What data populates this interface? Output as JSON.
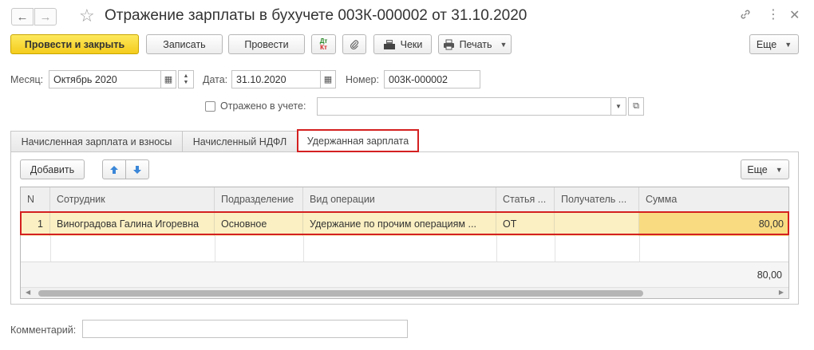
{
  "window": {
    "title": "Отражение зарплаты в бухучете 003К-000002 от 31.10.2020",
    "nav_back": "←",
    "nav_forward": "→",
    "icons": [
      "back-arrow-icon",
      "forward-arrow-icon",
      "star-icon",
      "link-icon",
      "more-icon",
      "close-icon"
    ]
  },
  "toolbar": {
    "post_and_close": "Провести и закрыть",
    "save": "Записать",
    "post": "Провести",
    "dtkt_dt": "Дт",
    "dtkt_kt": "Кт",
    "checks": "Чеки",
    "print": "Печать",
    "more": "Еще"
  },
  "form": {
    "month_label": "Месяц:",
    "month_value": "Октябрь 2020",
    "date_label": "Дата:",
    "date_value": "31.10.2020",
    "number_label": "Номер:",
    "number_value": "003К-000002",
    "reflected_label": "Отражено в учете:",
    "reflected_value": "",
    "comment_label": "Комментарий:",
    "comment_value": ""
  },
  "tabs": [
    {
      "label": "Начисленная зарплата и взносы",
      "active": false
    },
    {
      "label": "Начисленный НДФЛ",
      "active": false
    },
    {
      "label": "Удержанная зарплата",
      "active": true
    }
  ],
  "table_toolbar": {
    "add": "Добавить",
    "more": "Еще"
  },
  "table": {
    "columns": [
      "N",
      "Сотрудник",
      "Подразделение",
      "Вид операции",
      "Статья ...",
      "Получатель ...",
      "Сумма"
    ],
    "rows": [
      {
        "n": "1",
        "employee": "Виноградова Галина Игоревна",
        "department": "Основное",
        "operation": "Удержание по прочим операциям ...",
        "article": "ОТ",
        "recipient": "",
        "sum": "80,00"
      }
    ],
    "total_sum": "80,00"
  },
  "colors": {
    "primary_button": "#f4cc1c",
    "highlight_border": "#d42020",
    "selected_row": "#fbf0c3",
    "selected_cell": "#f9dc82"
  }
}
